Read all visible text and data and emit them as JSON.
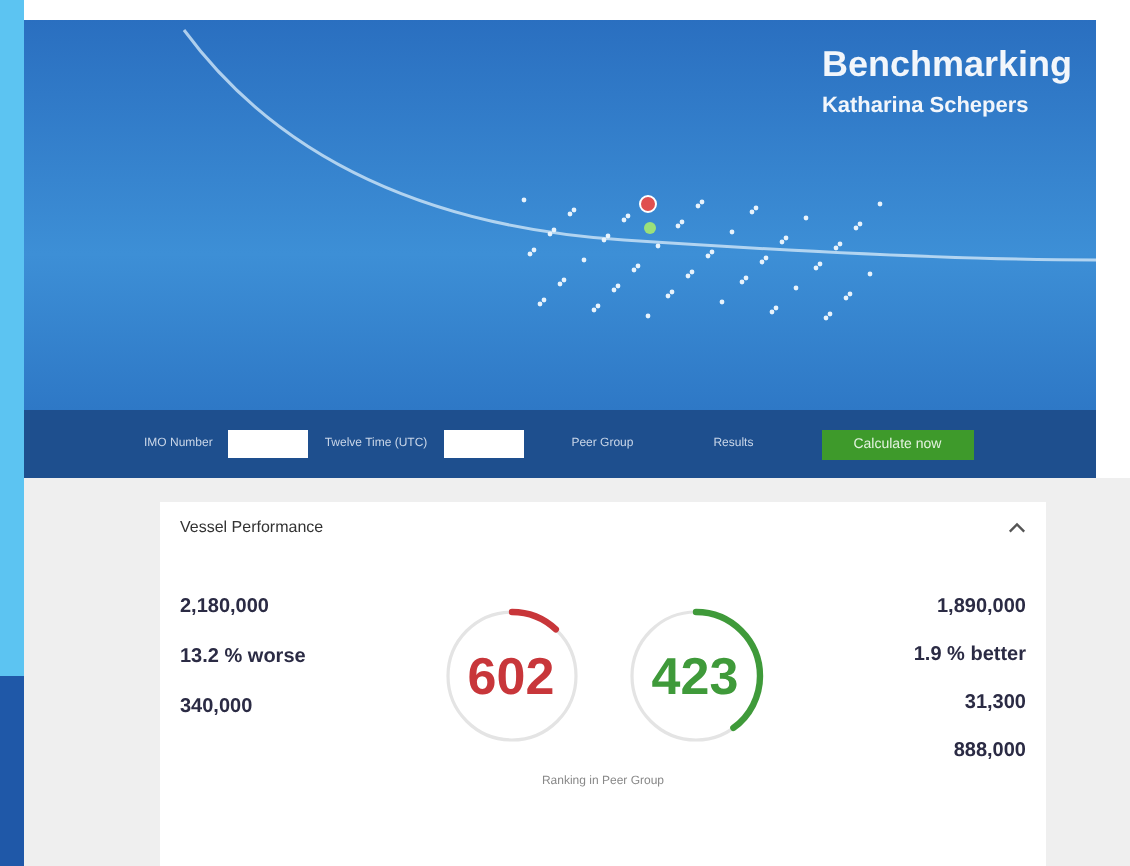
{
  "header": {
    "title": "Benchmarking",
    "subtitle": "Katharina Schepers"
  },
  "toolbar": {
    "fields": [
      {
        "label": "IMO Number"
      },
      {
        "label": "Twelve Time (UTC)"
      }
    ],
    "links": [
      "Peer Group",
      "Results"
    ],
    "button": "Calculate now"
  },
  "card": {
    "title": "Vessel Performance",
    "expanded": true,
    "left_stats": [
      "2,180,000",
      "13.2 % worse",
      "340,000"
    ],
    "gauges": [
      {
        "value": "602",
        "level": 0.12,
        "kind": "bad"
      },
      {
        "value": "423",
        "level": 0.4,
        "kind": "good"
      }
    ],
    "caption": "Ranking in Peer Group",
    "right_stats": [
      "1,890,000",
      "1.9 % better",
      "31,300",
      "888,000"
    ]
  }
}
